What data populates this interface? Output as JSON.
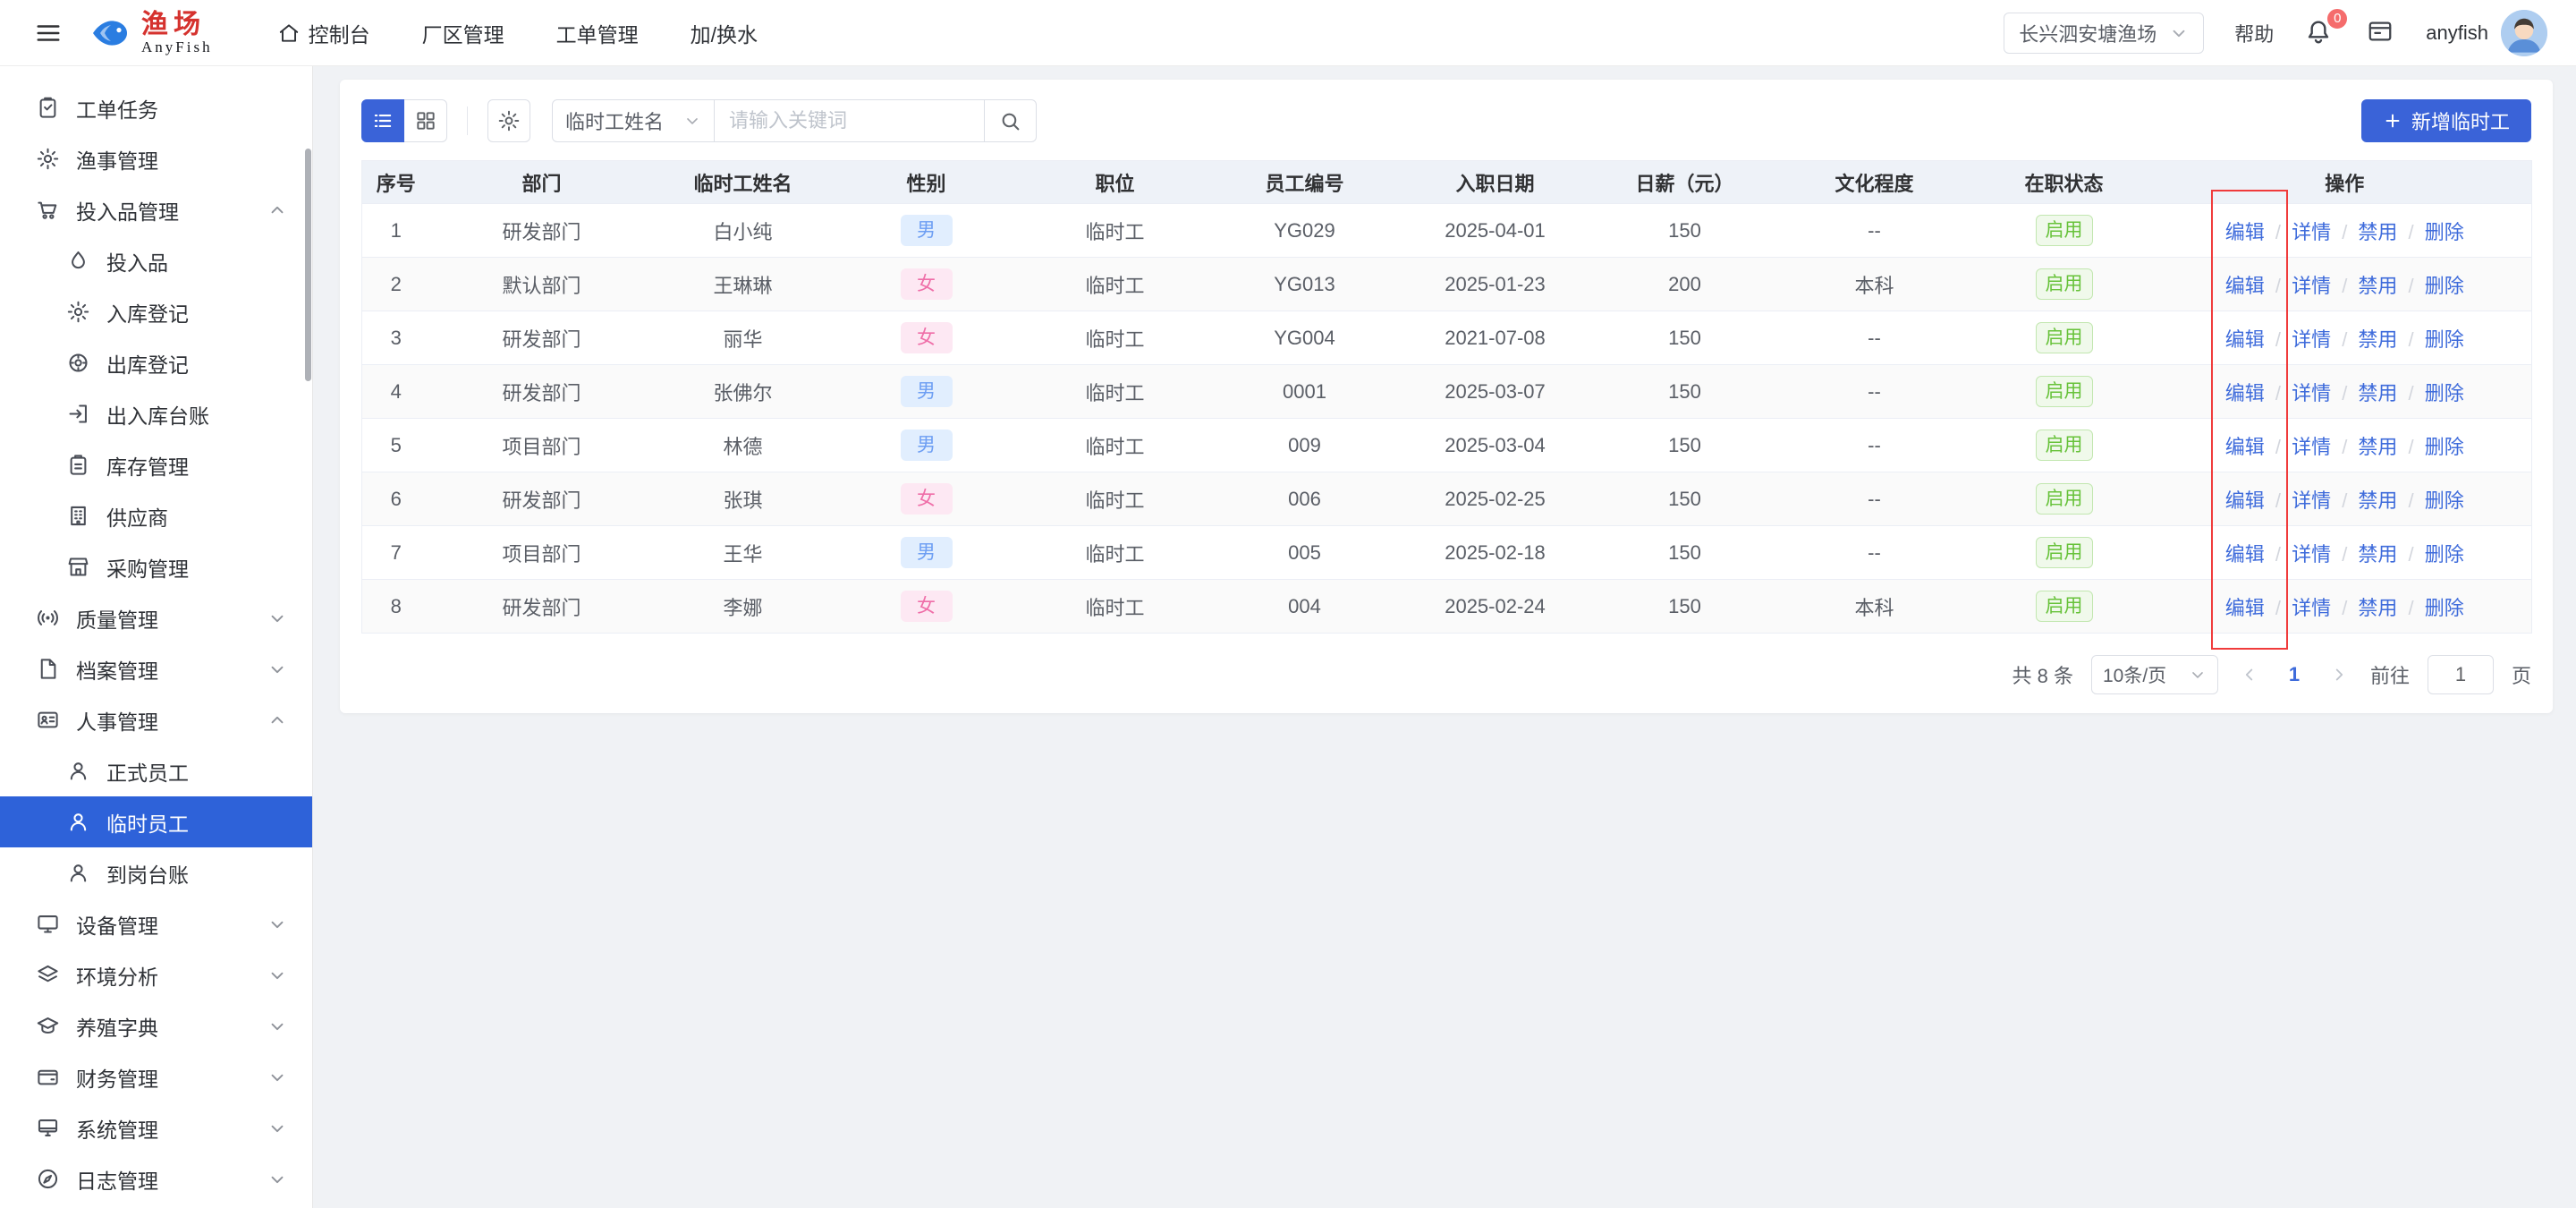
{
  "navbar": {
    "logo_title": "渔场",
    "logo_subtitle": "AnyFish",
    "menu": [
      {
        "label": "控制台"
      },
      {
        "label": "厂区管理"
      },
      {
        "label": "工单管理"
      },
      {
        "label": "加/换水"
      }
    ],
    "farm_selector": "长兴泗安塘渔场",
    "help_label": "帮助",
    "notification_count": "0",
    "username": "anyfish"
  },
  "sidebar": {
    "items": [
      {
        "label": "工单任务",
        "icon": "task-icon"
      },
      {
        "label": "渔事管理",
        "icon": "gear-icon"
      },
      {
        "label": "投入品管理",
        "icon": "cart-icon",
        "expanded": true,
        "children": [
          {
            "label": "投入品",
            "icon": "drop-icon"
          },
          {
            "label": "入库登记",
            "icon": "gear-icon"
          },
          {
            "label": "出库登记",
            "icon": "wheel-icon"
          },
          {
            "label": "出入库台账",
            "icon": "inout-icon"
          },
          {
            "label": "库存管理",
            "icon": "clipboard-icon"
          },
          {
            "label": "供应商",
            "icon": "building-icon"
          },
          {
            "label": "采购管理",
            "icon": "shop-icon"
          }
        ]
      },
      {
        "label": "质量管理",
        "icon": "signal-icon",
        "expanded": false
      },
      {
        "label": "档案管理",
        "icon": "file-icon",
        "expanded": false
      },
      {
        "label": "人事管理",
        "icon": "idcard-icon",
        "expanded": true,
        "children": [
          {
            "label": "正式员工",
            "icon": "user-icon"
          },
          {
            "label": "临时员工",
            "icon": "user-icon",
            "active": true
          },
          {
            "label": "到岗台账",
            "icon": "user-icon"
          }
        ]
      },
      {
        "label": "设备管理",
        "icon": "monitor-icon",
        "expanded": false
      },
      {
        "label": "环境分析",
        "icon": "layers-icon",
        "expanded": false
      },
      {
        "label": "养殖字典",
        "icon": "cap-icon",
        "expanded": false
      },
      {
        "label": "财务管理",
        "icon": "wallet-icon",
        "expanded": false
      },
      {
        "label": "系统管理",
        "icon": "desktop-icon",
        "expanded": false
      },
      {
        "label": "日志管理",
        "icon": "compass-icon",
        "expanded": false
      }
    ]
  },
  "toolbar": {
    "filter_field": "临时工姓名",
    "search_placeholder": "请输入关键词",
    "add_button_label": "新增临时工"
  },
  "table": {
    "headers": [
      "序号",
      "部门",
      "临时工姓名",
      "性别",
      "职位",
      "员工编号",
      "入职日期",
      "日薪（元）",
      "文化程度",
      "在职状态",
      "操作"
    ],
    "action_labels": [
      "编辑",
      "详情",
      "禁用",
      "删除"
    ],
    "rows": [
      {
        "index": "1",
        "department": "研发部门",
        "name": "白小纯",
        "gender": "男",
        "position": "临时工",
        "employee_no": "YG029",
        "hire_date": "2025-04-01",
        "daily_salary": "150",
        "education": "--",
        "status": "启用"
      },
      {
        "index": "2",
        "department": "默认部门",
        "name": "王琳琳",
        "gender": "女",
        "position": "临时工",
        "employee_no": "YG013",
        "hire_date": "2025-01-23",
        "daily_salary": "200",
        "education": "本科",
        "status": "启用"
      },
      {
        "index": "3",
        "department": "研发部门",
        "name": "丽华",
        "gender": "女",
        "position": "临时工",
        "employee_no": "YG004",
        "hire_date": "2021-07-08",
        "daily_salary": "150",
        "education": "--",
        "status": "启用"
      },
      {
        "index": "4",
        "department": "研发部门",
        "name": "张佛尔",
        "gender": "男",
        "position": "临时工",
        "employee_no": "0001",
        "hire_date": "2025-03-07",
        "daily_salary": "150",
        "education": "--",
        "status": "启用"
      },
      {
        "index": "5",
        "department": "项目部门",
        "name": "林德",
        "gender": "男",
        "position": "临时工",
        "employee_no": "009",
        "hire_date": "2025-03-04",
        "daily_salary": "150",
        "education": "--",
        "status": "启用"
      },
      {
        "index": "6",
        "department": "研发部门",
        "name": "张琪",
        "gender": "女",
        "position": "临时工",
        "employee_no": "006",
        "hire_date": "2025-02-25",
        "daily_salary": "150",
        "education": "--",
        "status": "启用"
      },
      {
        "index": "7",
        "department": "项目部门",
        "name": "王华",
        "gender": "男",
        "position": "临时工",
        "employee_no": "005",
        "hire_date": "2025-02-18",
        "daily_salary": "150",
        "education": "--",
        "status": "启用"
      },
      {
        "index": "8",
        "department": "研发部门",
        "name": "李娜",
        "gender": "女",
        "position": "临时工",
        "employee_no": "004",
        "hire_date": "2025-02-24",
        "daily_salary": "150",
        "education": "本科",
        "status": "启用"
      }
    ]
  },
  "pagination": {
    "total_label": "共 8 条",
    "page_size_label": "10条/页",
    "current_page": "1",
    "goto_label": "前往",
    "goto_value": "1",
    "page_unit_label": "页"
  },
  "colors": {
    "primary": "#3a63d8",
    "sidebar_active": "#2e62d9",
    "annotation_red": "#f03b3b",
    "male_badge": "#6d9ef3",
    "female_badge": "#ef6ea8",
    "status_enabled": "#67c23a"
  }
}
